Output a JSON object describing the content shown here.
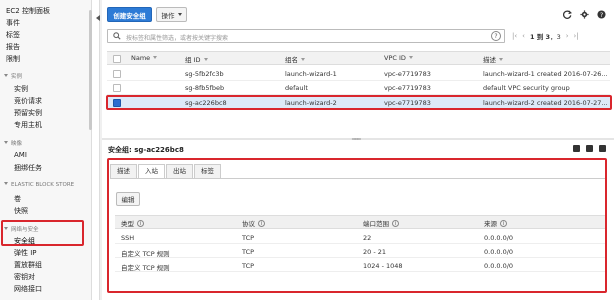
{
  "sidebar": {
    "top_items": [
      {
        "label": "EC2 控制面板"
      },
      {
        "label": "事件"
      },
      {
        "label": "标签"
      },
      {
        "label": "报告"
      },
      {
        "label": "限制"
      }
    ],
    "sections": [
      {
        "heading": "实例",
        "items": [
          "实例",
          "竞价请求",
          "预留实例",
          "专用主机"
        ]
      },
      {
        "heading": "映像",
        "items": [
          "AMI",
          "捆绑任务"
        ]
      },
      {
        "heading": "ELASTIC BLOCK STORE",
        "items": [
          "卷",
          "快照"
        ]
      },
      {
        "heading": "网络与安全",
        "items": [
          "安全组",
          "弹性 IP",
          "置放群组",
          "密钥对",
          "网络接口"
        ]
      }
    ],
    "selected_item": "安全组"
  },
  "toolbar": {
    "create_label": "创建安全组",
    "actions_label": "操作",
    "icons": [
      "refresh-icon",
      "gear-icon",
      "help-icon"
    ]
  },
  "filter": {
    "placeholder": "按标签和属性筛选，或者按关键字搜索",
    "pager": {
      "range": "1 到 3",
      "total_prefix": "，3",
      "total": "3"
    }
  },
  "table": {
    "columns": [
      "Name",
      "组 ID",
      "组名",
      "VPC ID",
      "描述"
    ],
    "rows": [
      {
        "name": "",
        "group_id": "sg-5fb2fc3b",
        "group_name": "launch-wizard-1",
        "vpc_id": "vpc-e7719783",
        "description": "launch-wizard-1 created 2016-07-26...",
        "selected": false
      },
      {
        "name": "",
        "group_id": "sg-8fb5fbeb",
        "group_name": "default",
        "vpc_id": "vpc-e7719783",
        "description": "default VPC security group",
        "selected": false
      },
      {
        "name": "",
        "group_id": "sg-ac226bc8",
        "group_name": "launch-wizard-2",
        "vpc_id": "vpc-e7719783",
        "description": "launch-wizard-2 created 2016-07-27...",
        "selected": true
      }
    ]
  },
  "detail": {
    "title": "安全组: sg-ac226bc8",
    "tabs": [
      "描述",
      "入站",
      "出站",
      "标签"
    ],
    "active_tab": "入站",
    "edit_label": "编辑",
    "rule_columns": [
      "类型",
      "协议",
      "端口范围",
      "来源"
    ],
    "rules": [
      {
        "type": "SSH",
        "protocol": "TCP",
        "port": "22",
        "source": "0.0.0.0/0"
      },
      {
        "type": "自定义 TCP 规则",
        "protocol": "TCP",
        "port": "20 - 21",
        "source": "0.0.0.0/0"
      },
      {
        "type": "自定义 TCP 规则",
        "protocol": "TCP",
        "port": "1024 - 1048",
        "source": "0.0.0.0/0"
      }
    ]
  },
  "colors": {
    "primary": "#2d7bd6",
    "highlight": "#d9262d",
    "selected_row": "#dde9f8"
  }
}
